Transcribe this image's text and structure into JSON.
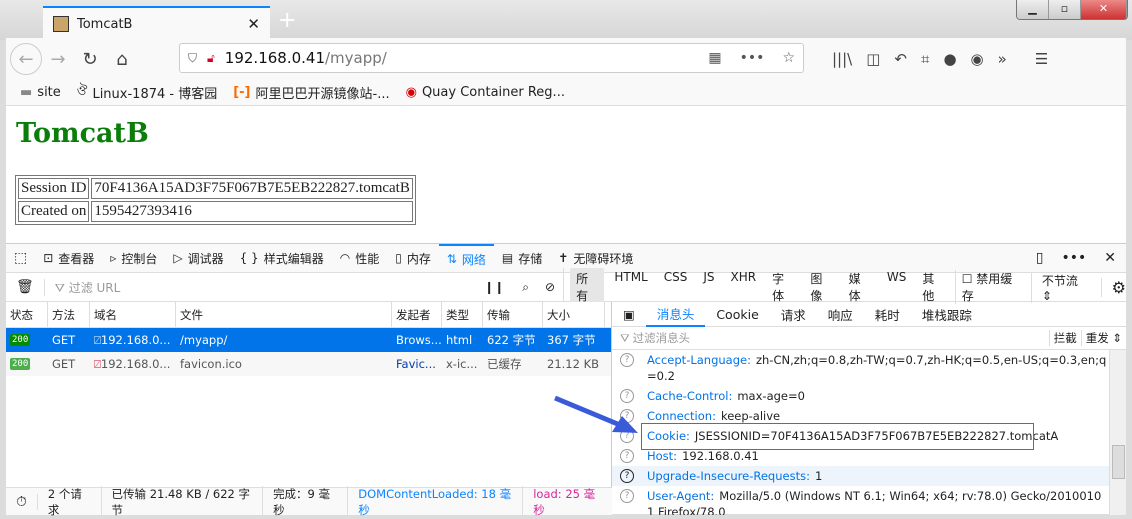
{
  "browser": {
    "tab_title": "TomcatB",
    "url_host": "192.168.0.41",
    "url_path": "/myapp/",
    "bookmarks": [
      "site",
      "Linux-1874 - 博客园",
      "阿里巴巴开源镜像站-...",
      "Quay Container Reg..."
    ]
  },
  "page": {
    "heading": "TomcatB",
    "session_label": "Session ID",
    "session_value": "70F4136A15AD3F75F067B7E5EB222827.tomcatB",
    "created_label": "Created on",
    "created_value": "1595427393416"
  },
  "devtools": {
    "tabs": [
      "查看器",
      "控制台",
      "调试器",
      "样式编辑器",
      "性能",
      "内存",
      "网络",
      "存储",
      "无障碍环境"
    ],
    "filter_placeholder": "过滤 URL",
    "types": [
      "所有",
      "HTML",
      "CSS",
      "JS",
      "XHR",
      "字体",
      "图像",
      "媒体",
      "WS",
      "其他"
    ],
    "disable_cache": "禁用缓存",
    "throttle": "不节流 ⇕",
    "columns": [
      "状态",
      "方法",
      "域名",
      "文件",
      "发起者",
      "类型",
      "传输",
      "大小"
    ],
    "requests": [
      {
        "status": "200",
        "method": "GET",
        "domain": "192.168.0...",
        "file": "/myapp/",
        "initiator": "Brows...",
        "type": "html",
        "transferred": "622 字节",
        "size": "367 字节"
      },
      {
        "status": "200",
        "method": "GET",
        "domain": "192.168.0...",
        "file": "favicon.ico",
        "initiator": "Favic...",
        "type": "x-ic...",
        "transferred": "已缓存",
        "size": "21.12 KB"
      }
    ],
    "statusbar": {
      "requests": "2 个请求",
      "transferred": "已传输 21.48 KB / 622 字节",
      "finish": "完成：9 毫秒",
      "dcl": "DOMContentLoaded: 18 毫秒",
      "load": "load: 25 毫秒"
    },
    "detail_tabs": [
      "消息头",
      "Cookie",
      "请求",
      "响应",
      "耗时",
      "堆栈跟踪"
    ],
    "header_filter": "过滤消息头",
    "block": "拦截",
    "resend": "重发 ⇕",
    "headers": [
      {
        "k": "Accept-Language:",
        "v": "zh-CN,zh;q=0.8,zh-TW;q=0.7,zh-HK;q=0.5,en-US;q=0.3,en;q=0.2"
      },
      {
        "k": "Cache-Control:",
        "v": "max-age=0"
      },
      {
        "k": "Connection:",
        "v": "keep-alive"
      },
      {
        "k": "Cookie:",
        "v": "JSESSIONID=70F4136A15AD3F75F067B7E5EB222827.tomcatA"
      },
      {
        "k": "Host:",
        "v": "192.168.0.41"
      },
      {
        "k": "Upgrade-Insecure-Requests:",
        "v": "1"
      },
      {
        "k": "User-Agent:",
        "v": "Mozilla/5.0 (Windows NT 6.1; Win64; x64; rv:78.0) Gecko/20100101 Firefox/78.0"
      }
    ]
  },
  "colors": {
    "accent": "#0a84ff",
    "heading": "#0a7d0a",
    "selected_row": "#0074e8",
    "load": "#d7259b"
  }
}
